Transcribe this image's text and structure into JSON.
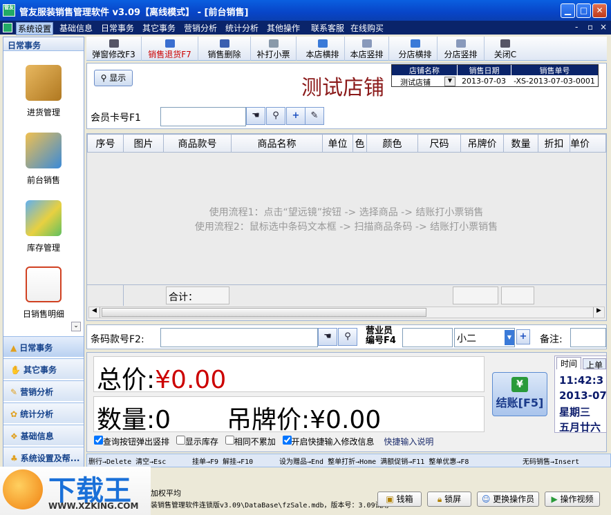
{
  "window": {
    "title": "管友服装销售管理软件  v3.09【离线模式】 - [前台销售]",
    "app_icon": "管友"
  },
  "menu": [
    "系统设置",
    "基础信息",
    "日常事务",
    "其它事务",
    "营销分析",
    "统计分析",
    "其他操作",
    "联系客服",
    "在线购买"
  ],
  "mdi_controls": [
    "-",
    "▫",
    "×"
  ],
  "sidebar": {
    "header": "日常事务",
    "items": [
      "进货管理",
      "前台销售",
      "库存管理",
      "日销售明细"
    ],
    "groups": [
      "日常事务",
      "其它事务",
      "营销分析",
      "统计分析",
      "基础信息",
      "系统设置及帮..."
    ]
  },
  "toolbar": [
    "弹窗修改F3",
    "销售退货F7",
    "销售删除",
    "补打小票",
    "本店横排",
    "本店竖排",
    "分店横排",
    "分店竖排",
    "关闭C"
  ],
  "show_button": "显示",
  "store_title": "测试店铺",
  "info": {
    "headers": [
      "店铺名称",
      "销售日期",
      "销售单号"
    ],
    "store": "测试店铺",
    "date": "2013-07-03",
    "order_no": "-XS-2013-07-03-0001"
  },
  "member": {
    "label": "会员卡号F1",
    "value": ""
  },
  "columns": [
    "序号",
    "图片",
    "商品款号",
    "商品名称",
    "单位",
    "色",
    "颜色",
    "尺码",
    "吊牌价",
    "数量",
    "折扣",
    "单价"
  ],
  "hints": [
    "使用流程1：点击“望远镜”按钮 -> 选择商品 -> 结账打小票销售",
    "使用流程2：鼠标选中条码文本框 -> 扫描商品条码 -> 结账打小票销售"
  ],
  "total_row_label": "合计：",
  "barcode": {
    "label": "条码款号F2:",
    "value": ""
  },
  "salesperson": {
    "label1": "营业员",
    "label2": "编号F4",
    "value": "",
    "name": "小二"
  },
  "note_label": "备注:",
  "totals": {
    "price_label": "总价",
    "price_value": "¥0.00",
    "qty_label": "数量",
    "qty_value": "0",
    "tag_label": "吊牌价",
    "tag_value": "¥0.00"
  },
  "checkout": {
    "label": "结账[F5]"
  },
  "options": [
    {
      "label": "查询按钮弹出竖排",
      "checked": true
    },
    {
      "label": "显示库存",
      "checked": false
    },
    {
      "label": "相同不累加",
      "checked": false
    },
    {
      "label": "开启快捷输入修改信息",
      "checked": true
    }
  ],
  "quick_help": "快捷输入说明",
  "clock": {
    "tabs": [
      "时间",
      "上单"
    ],
    "time": "11:42:3",
    "date": "2013-07",
    "weekday": "星期三",
    "lunar": "五月廿六"
  },
  "shortcuts": [
    "删行→Delete 清空→Esc",
    "挂单→F9 解挂→F10",
    "设为赠品→End 整单打折→Home 满额促销→F11 整单优惠→F8",
    "无码销售→Insert"
  ],
  "status": {
    "line1": "加权平均",
    "line2": "装销售管理软件连锁版v3.09\\DataBase\\fzSale.mdb，版本号：3.09试用"
  },
  "bottom_buttons": [
    "钱箱",
    "锁屏",
    "更换操作员",
    "操作视频"
  ],
  "watermark": {
    "brand": "下载王",
    "url": "WWW.XZKING.COM"
  }
}
